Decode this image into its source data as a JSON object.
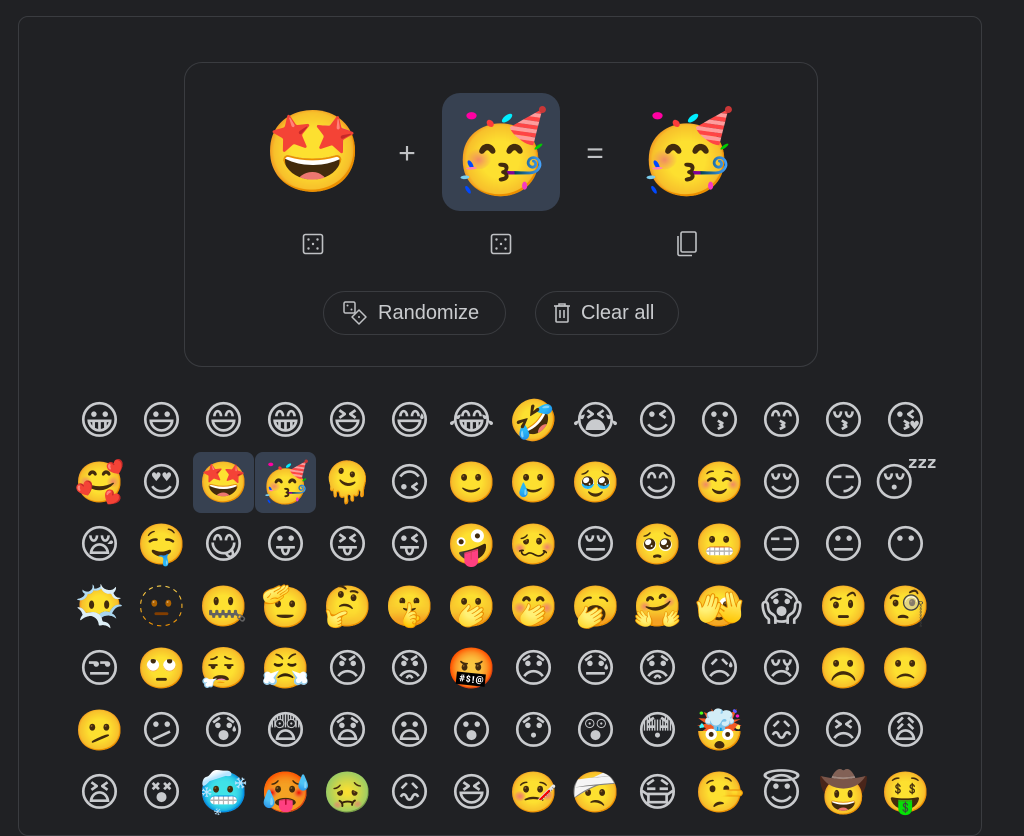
{
  "mixer": {
    "left_emoji": "🤩",
    "left_emoji_name": "star-struck",
    "right_emoji": "🥳",
    "right_emoji_name": "partying face",
    "result_emoji": "🤩🥳",
    "result_display": "🥳",
    "plus_symbol": "+",
    "equals_symbol": "=",
    "left_randomize_icon": "dice-five-icon",
    "right_randomize_icon": "dice-three-icon",
    "copy_icon": "copy-icon",
    "selected_slot": "right",
    "randomize_label": "Randomize",
    "clear_all_label": "Clear all"
  },
  "colors": {
    "background": "#202124",
    "border": "#3a3c40",
    "selected": "#374151",
    "text": "#c9cbce"
  },
  "grid": {
    "selected": [
      "🤩",
      "🥳"
    ],
    "rows": [
      [
        "😀",
        "😃",
        "😄",
        "😁",
        "😆",
        "😅",
        "😂",
        "🤣",
        "😭",
        "😉",
        "😗",
        "😙",
        "😚",
        "😘"
      ],
      [
        "🥰",
        "😍",
        "🤩",
        "🥳",
        "🫠",
        "🙃",
        "🙂",
        "🥲",
        "🥹",
        "😊",
        "☺️",
        "😌",
        "😏",
        "😴"
      ],
      [
        "😪",
        "🤤",
        "😋",
        "😛",
        "😝",
        "😜",
        "🤪",
        "🥴",
        "😔",
        "🥺",
        "😬",
        "😑",
        "😐",
        "😶"
      ],
      [
        "😶‍🌫️",
        "🫥",
        "🤐",
        "🫡",
        "🤔",
        "🤫",
        "🫢",
        "🤭",
        "🥱",
        "🤗",
        "🫣",
        "😱",
        "🤨",
        "🧐"
      ],
      [
        "😒",
        "🙄",
        "😮‍💨",
        "😤",
        "😠",
        "😡",
        "🤬",
        "😞",
        "😓",
        "😟",
        "😥",
        "😢",
        "☹️",
        "🙁"
      ],
      [
        "🫤",
        "😕",
        "😰",
        "😨",
        "😧",
        "😦",
        "😮",
        "😯",
        "😲",
        "😳",
        "🤯",
        "😖",
        "😣",
        "😩"
      ],
      [
        "😫",
        "😵",
        "🥶",
        "🥵",
        "🤢",
        "😖",
        "😆",
        "🤒",
        "🤕",
        "😷",
        "🤥",
        "😇",
        "🤠",
        "🤑"
      ]
    ]
  }
}
